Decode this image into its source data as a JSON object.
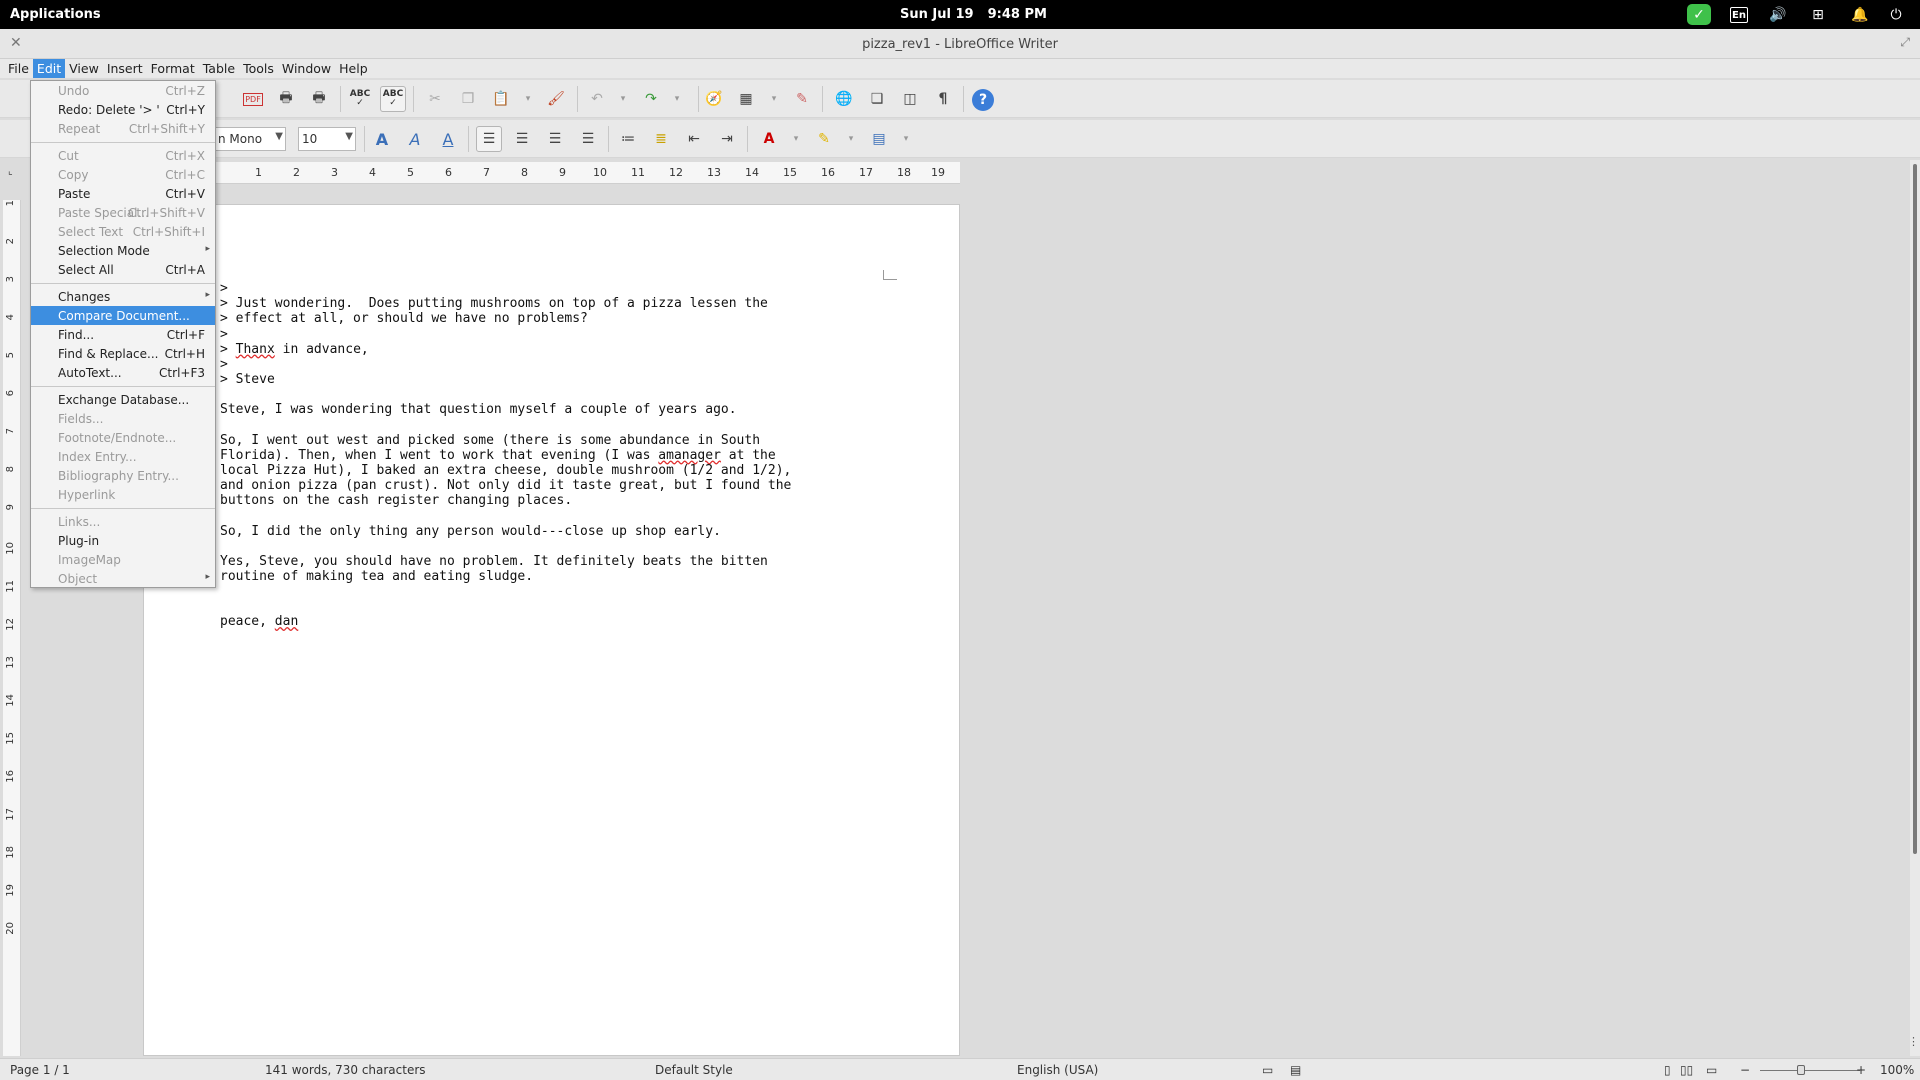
{
  "panel": {
    "applications": "Applications",
    "date": "Sun Jul 19",
    "time": "9:48 PM",
    "keyboard_layout": "En",
    "icons": [
      "check-icon",
      "keyboard-layout-icon",
      "volume-icon",
      "network-icon",
      "notification-bell-icon",
      "power-icon"
    ]
  },
  "window": {
    "title": "pizza_rev1 - LibreOffice Writer"
  },
  "menubar": {
    "items": [
      "File",
      "Edit",
      "View",
      "Insert",
      "Format",
      "Table",
      "Tools",
      "Window",
      "Help"
    ],
    "active": "Edit"
  },
  "toolbar": {
    "font_name": "n Mono",
    "font_size": "10"
  },
  "ruler": {
    "ticks": [
      "1",
      "2",
      "3",
      "4",
      "5",
      "6",
      "7",
      "8",
      "9",
      "10",
      "11",
      "12",
      "13",
      "14",
      "15",
      "16",
      "17",
      "18",
      "19"
    ]
  },
  "vruler": {
    "ticks": [
      "1",
      "2",
      "3",
      "4",
      "5",
      "6",
      "7",
      "8",
      "9",
      "10",
      "11",
      "12",
      "13",
      "14",
      "15",
      "16",
      "17",
      "18",
      "19",
      "20"
    ]
  },
  "edit_menu": {
    "undo": {
      "label": "Undo",
      "shortcut": "Ctrl+Z"
    },
    "redo": {
      "label": "Redo: Delete '> '",
      "shortcut": "Ctrl+Y"
    },
    "repeat": {
      "label": "Repeat",
      "shortcut": "Ctrl+Shift+Y"
    },
    "cut": {
      "label": "Cut",
      "shortcut": "Ctrl+X"
    },
    "copy": {
      "label": "Copy",
      "shortcut": "Ctrl+C"
    },
    "paste": {
      "label": "Paste",
      "shortcut": "Ctrl+V"
    },
    "paste_special": {
      "label": "Paste Special...",
      "shortcut": "Ctrl+Shift+V"
    },
    "select_text": {
      "label": "Select Text",
      "shortcut": "Ctrl+Shift+I"
    },
    "selection_mode": {
      "label": "Selection Mode"
    },
    "select_all": {
      "label": "Select All",
      "shortcut": "Ctrl+A"
    },
    "changes": {
      "label": "Changes"
    },
    "compare_document": {
      "label": "Compare Document..."
    },
    "find": {
      "label": "Find...",
      "shortcut": "Ctrl+F"
    },
    "find_replace": {
      "label": "Find & Replace...",
      "shortcut": "Ctrl+H"
    },
    "autotext": {
      "label": "AutoText...",
      "shortcut": "Ctrl+F3"
    },
    "exchange_database": {
      "label": "Exchange Database..."
    },
    "fields": {
      "label": "Fields..."
    },
    "footnote_endnote": {
      "label": "Footnote/Endnote..."
    },
    "index_entry": {
      "label": "Index Entry..."
    },
    "bibliography_entry": {
      "label": "Bibliography Entry..."
    },
    "hyperlink": {
      "label": "Hyperlink"
    },
    "links": {
      "label": "Links..."
    },
    "plugin": {
      "label": "Plug-in"
    },
    "imagemap": {
      "label": "ImageMap"
    },
    "object": {
      "label": "Object"
    }
  },
  "document": {
    "line1": ">",
    "line2": "> Just wondering.  Does putting mushrooms on top of a pizza lessen the",
    "line3": "> effect at all, or should we have no problems?",
    "line4": ">",
    "line5_pre": "> ",
    "line5_word": "Thanx",
    "line5_post": " in advance,",
    "line6": ">",
    "line7": "> Steve",
    "para1": "Steve, I was wondering that question myself a couple of years ago.",
    "para2_l1": "So, I went out west and picked some (there is some abundance in South",
    "para2_l2_pre": "Florida). Then, when I went to work that evening (I was ",
    "para2_l2_word": "amanager",
    "para2_l2_post": " at the",
    "para2_l3": "local Pizza Hut), I baked an extra cheese, double mushroom (1/2 and 1/2),",
    "para2_l4": "and onion pizza (pan crust). Not only did it taste great, but I found the",
    "para2_l5": "buttons on the cash register changing places.",
    "para3": "So, I did the only thing any person would---close up shop early.",
    "para4_l1": "Yes, Steve, you should have no problem. It definitely beats the bitten",
    "para4_l2": "routine of making tea and eating sludge.",
    "sign_pre": "peace, ",
    "sign_word": "dan"
  },
  "status": {
    "page": "Page 1 / 1",
    "counts": "141 words, 730 characters",
    "style": "Default Style",
    "language": "English (USA)",
    "zoom": "100%"
  },
  "colors": {
    "accent": "#3d8ee0",
    "panel_bg": "#000000",
    "toolbar_bg": "#e9e9e9",
    "spell_error": "#e03030"
  }
}
